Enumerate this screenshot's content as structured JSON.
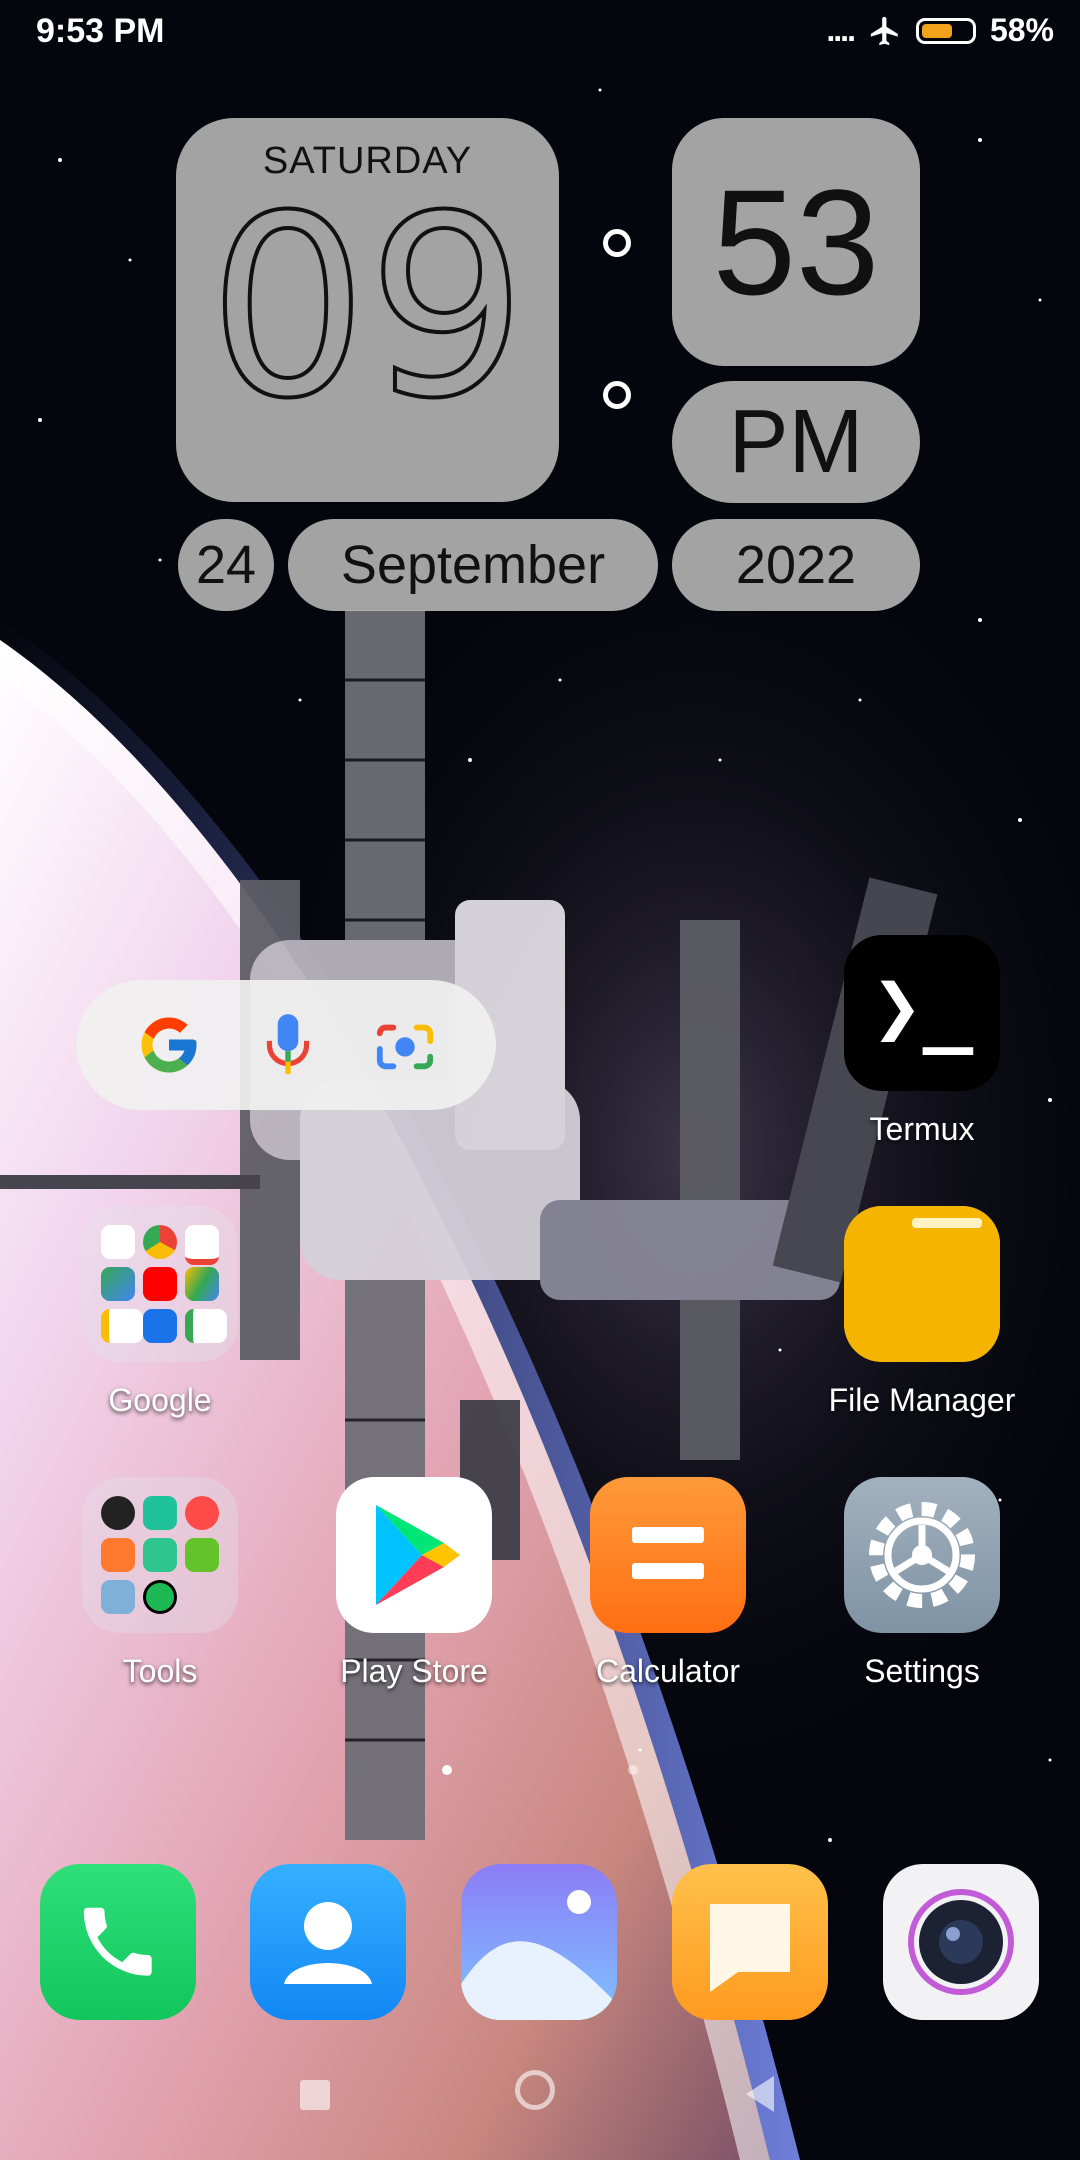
{
  "status_bar": {
    "time": "9:53 PM",
    "signal_text": "....",
    "airplane_icon": "airplane-icon",
    "battery_percent": "58%",
    "battery_level": 0.58
  },
  "clock_widget": {
    "weekday": "SATURDAY",
    "hour": "09",
    "minute": "53",
    "ampm": "PM",
    "day": "24",
    "month": "September",
    "year": "2022"
  },
  "search_widget": {
    "icons": [
      "google-g-icon",
      "microphone-icon",
      "lens-camera-icon"
    ]
  },
  "apps": {
    "termux": {
      "label": "Termux",
      "glyph": "❯_"
    },
    "google_folder": {
      "label": "Google"
    },
    "file_manager": {
      "label": "File Manager"
    },
    "tools_folder": {
      "label": "Tools"
    },
    "play_store": {
      "label": "Play Store"
    },
    "calculator": {
      "label": "Calculator"
    },
    "settings": {
      "label": "Settings"
    }
  },
  "dock": [
    "phone-icon",
    "contacts-icon",
    "gallery-icon",
    "messages-icon",
    "camera-icon"
  ],
  "page_indicator": {
    "pages": 2,
    "current": 1
  },
  "colors": {
    "widget_bg": "#b9b9b9",
    "termux_bg": "#000000",
    "file_manager_bg": "#f4b400",
    "calculator_bg": "#ff7f1e",
    "settings_bg": "#8d9fae",
    "phone_bg": "#1fd86a",
    "contacts_bg": "#1a9cff",
    "messages_bg": "#ffb02e"
  }
}
